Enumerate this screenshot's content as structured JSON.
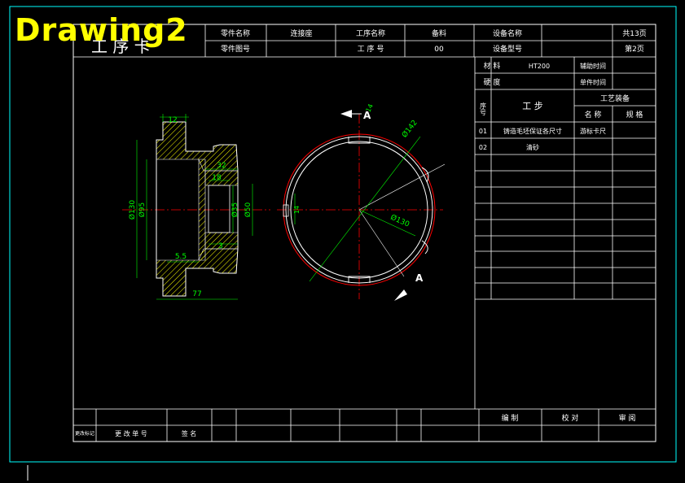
{
  "overlay": {
    "title": "Drawing2"
  },
  "title_block": {
    "process_card_big": "工 序 卡",
    "part_name_label": "零件名称",
    "part_name_value": "连接座",
    "proc_name_label": "工序名称",
    "proc_name_value": "备料",
    "equip_name_label": "设备名称",
    "total_pages": "共13页",
    "part_no_label": "零件图号",
    "proc_no_label": "工 序 号",
    "proc_no_value": "00",
    "equip_model_label": "设备型号",
    "page_no": "第2页"
  },
  "info_panel": {
    "material_label": "材 料",
    "material_value": "HT200",
    "aux_time_label": "辅助时间",
    "hardness_label": "硬 度",
    "unit_time_label": "单件时间",
    "seq_label": "序号",
    "step_label": "工 步",
    "equip_header": "工艺装备",
    "name_label": "名 称",
    "spec_label": "规 格",
    "steps": [
      {
        "no": "01",
        "desc": "铸造毛坯保证各尺寸",
        "tool": "游标卡尺"
      },
      {
        "no": "02",
        "desc": "清砂",
        "tool": ""
      }
    ]
  },
  "bottom_block": {
    "change_mark": "更改标记",
    "change_doc_no": "更 改 单 号",
    "signature": "签 名",
    "compile": "编 制",
    "proofread": "校 对",
    "review": "审 阅"
  },
  "drawing": {
    "section_dims": [
      "12",
      "32",
      "18",
      "Ø35",
      "Ø50",
      "3",
      "5.5",
      "77",
      "Ø130",
      "Ø95"
    ],
    "plan_dims": [
      "Ø142",
      "Ø130",
      "14",
      "14"
    ],
    "section_letters": [
      "A",
      "A"
    ]
  },
  "colors": {
    "background": "#000000",
    "frame": "#00ffff",
    "lines": "#ffffff",
    "dimensions": "#00ff00",
    "centerline": "#ff0000",
    "overlay_title": "#ffff00"
  }
}
